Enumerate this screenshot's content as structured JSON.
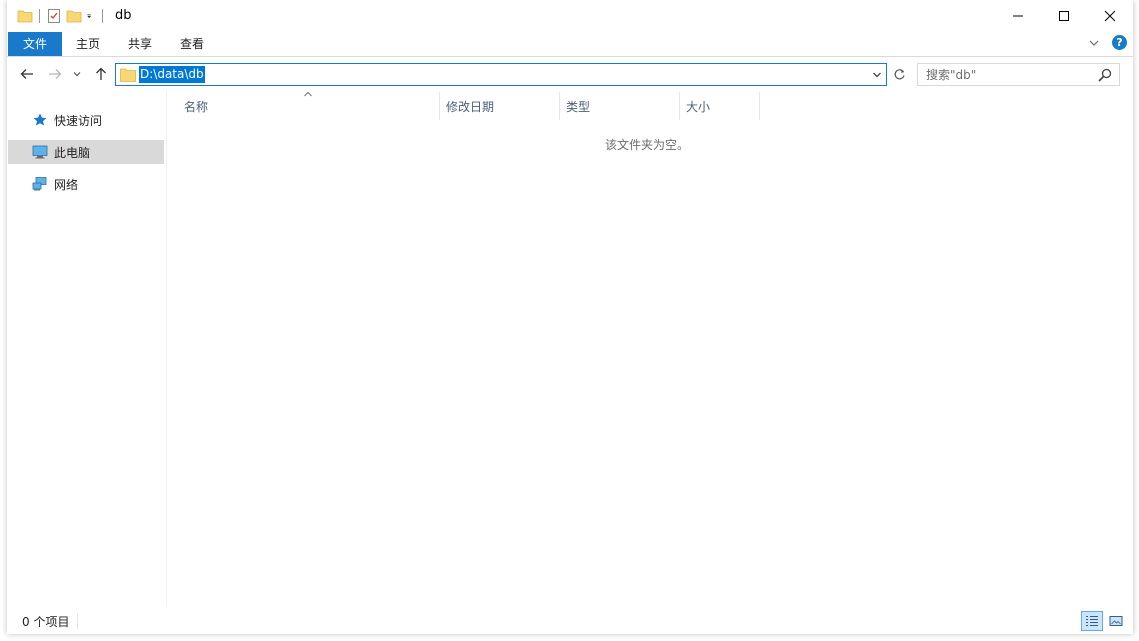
{
  "window": {
    "title": "db"
  },
  "window_controls": {
    "minimize": "—",
    "maximize": "☐",
    "close": "✕"
  },
  "ribbon": {
    "tabs": [
      {
        "label": "文件"
      },
      {
        "label": "主页"
      },
      {
        "label": "共享"
      },
      {
        "label": "查看"
      }
    ],
    "expand": "∨",
    "help": "?"
  },
  "address": {
    "path": "D:\\data\\db"
  },
  "search": {
    "placeholder": "搜索\"db\""
  },
  "nav_pane": {
    "items": [
      {
        "label": "快速访问"
      },
      {
        "label": "此电脑"
      },
      {
        "label": "网络"
      }
    ]
  },
  "columns": [
    {
      "label": "名称"
    },
    {
      "label": "修改日期"
    },
    {
      "label": "类型"
    },
    {
      "label": "大小"
    }
  ],
  "empty_message": "该文件夹为空。",
  "status": {
    "item_count": "0 个项目"
  },
  "colors": {
    "accent": "#1979ca",
    "selection": "#0078d7",
    "nav_selected": "#d9d9d9"
  }
}
